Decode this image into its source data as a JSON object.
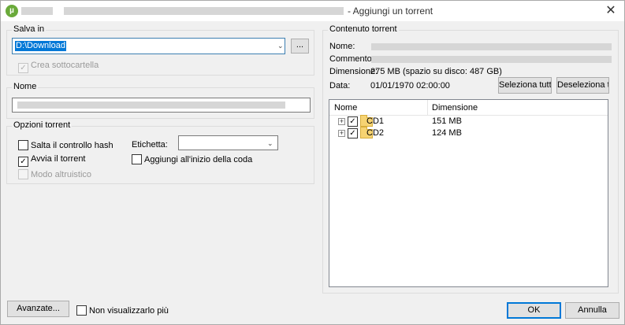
{
  "window": {
    "title": "- Aggiungi un torrent",
    "close_glyph": "✕"
  },
  "save": {
    "group_label": "Salva in",
    "path": "D:\\Download",
    "browse_label": "...",
    "subfolder_label": "Crea sottocartella",
    "subfolder_checked": true
  },
  "name_group": {
    "label": "Nome"
  },
  "options": {
    "label": "Opzioni torrent",
    "skip_hash": "Salta il controllo hash",
    "start": "Avvia il torrent",
    "altruistic": "Modo altruistico",
    "tag_label": "Etichetta:",
    "queue_top": "Aggiungi all'inizio della coda"
  },
  "content": {
    "label": "Contenuto torrent",
    "name_label": "Nome:",
    "comment_label": "Commento:",
    "size_label": "Dimensione:",
    "size_value": "275 MB (spazio su disco: 487 GB)",
    "date_label": "Data:",
    "date_value": "01/01/1970 02:00:00",
    "select_all": "Seleziona tutto",
    "deselect_all": "Deseleziona tutto",
    "col_name": "Nome",
    "col_size": "Dimensione",
    "files": [
      {
        "name": "CD1",
        "size": "151 MB"
      },
      {
        "name": "CD2",
        "size": "124 MB"
      }
    ]
  },
  "footer": {
    "advanced": "Avanzate...",
    "dont_show": "Non visualizzarlo più",
    "ok": "OK",
    "cancel": "Annulla"
  },
  "icons": {
    "app": "utorrent-icon",
    "check": "✓",
    "expand": "+",
    "chevron": "⌄"
  },
  "colors": {
    "accent": "#0078d7",
    "app_icon": "#6aaa3a",
    "folder": "#f6d372"
  }
}
